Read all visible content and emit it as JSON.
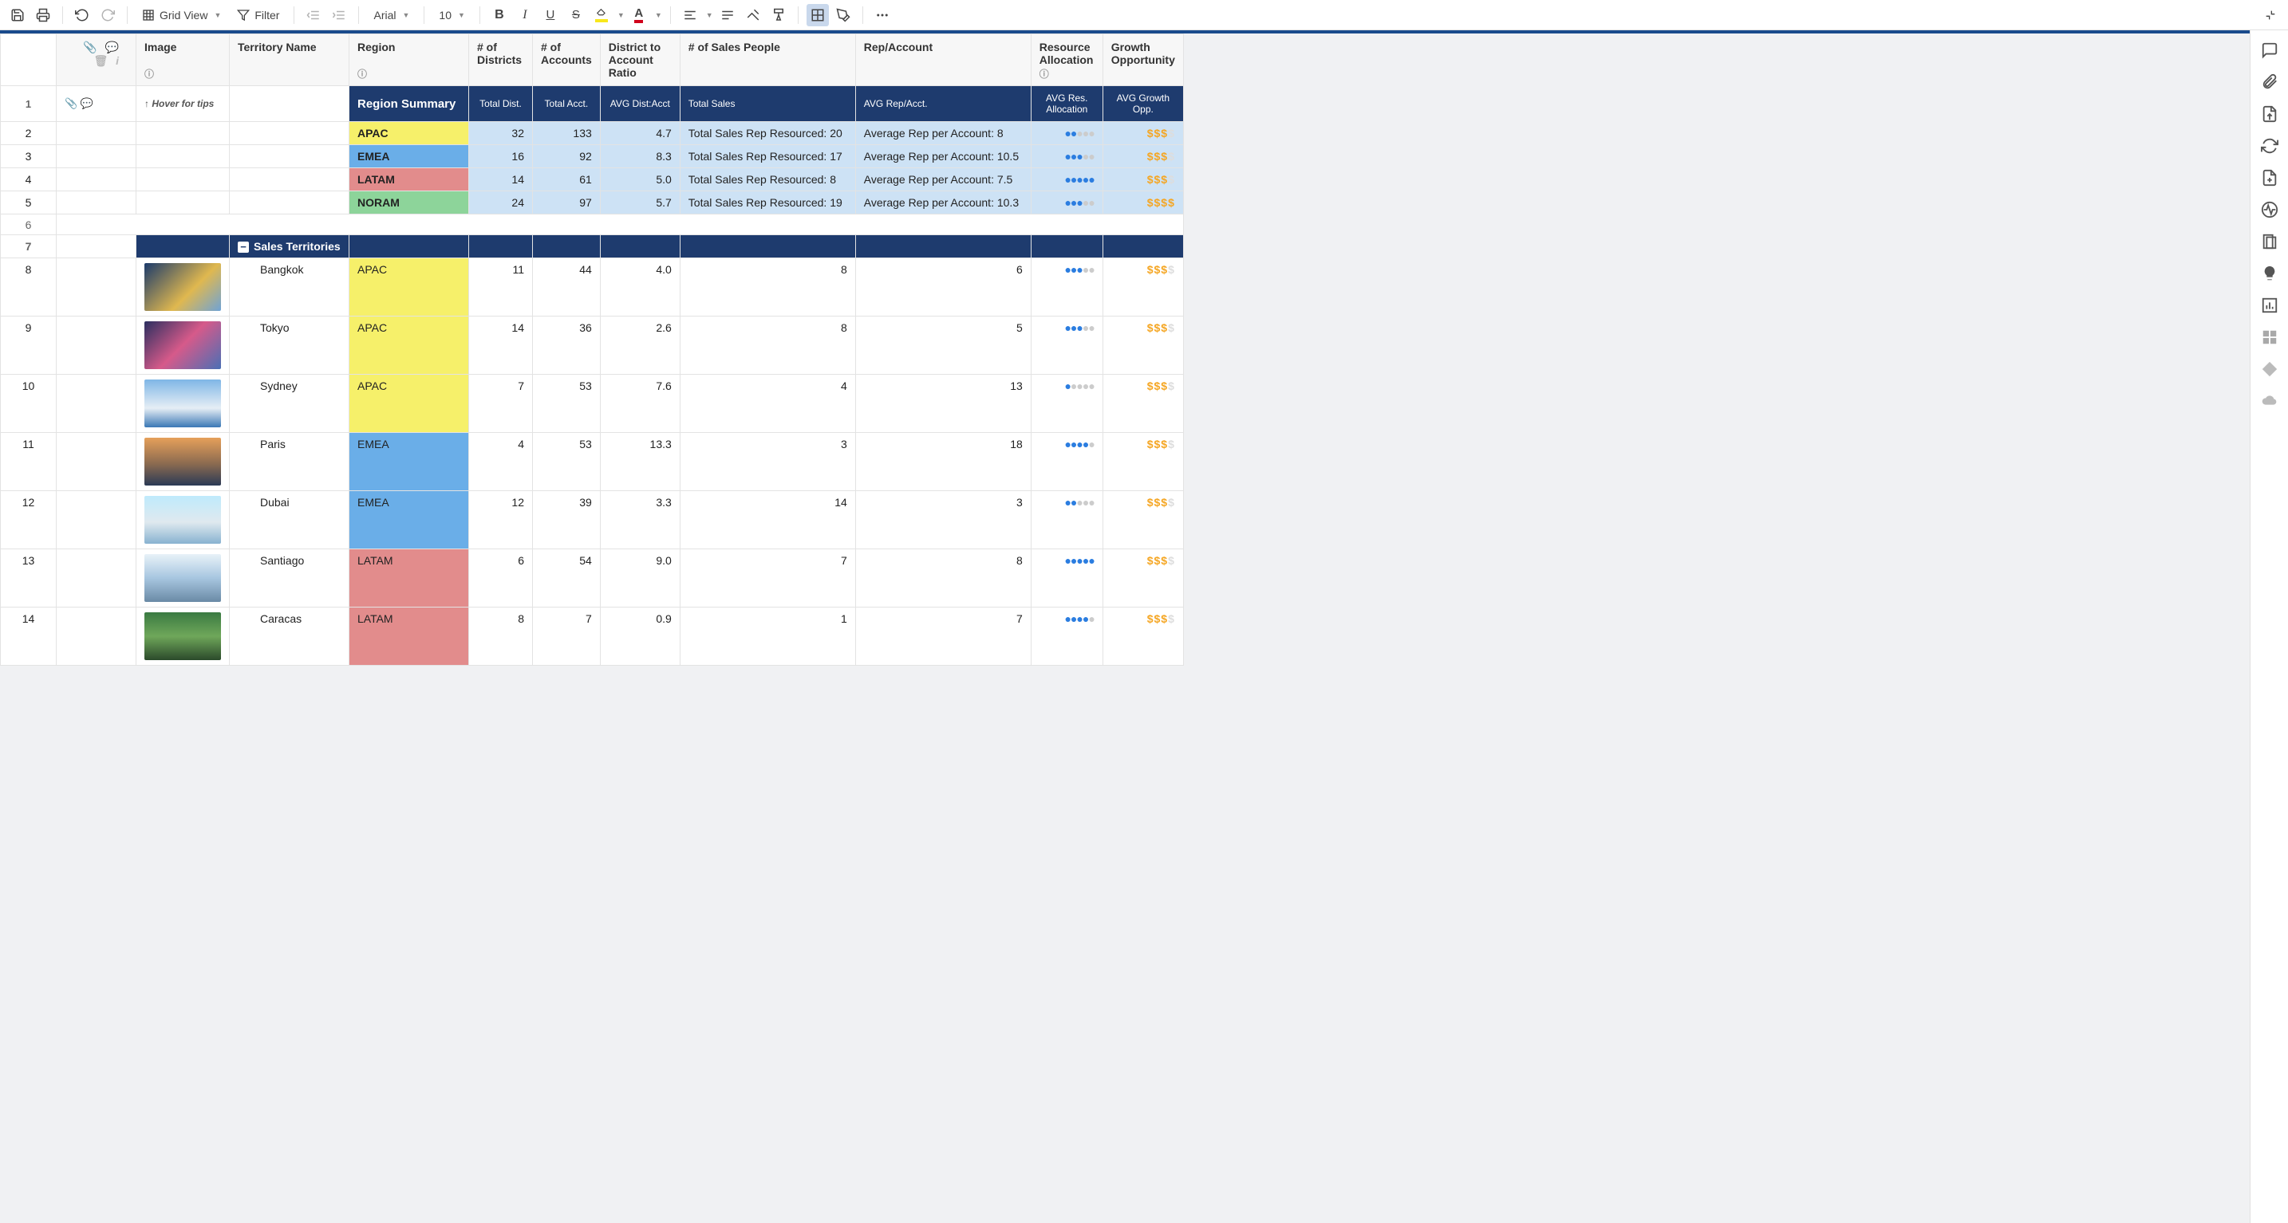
{
  "toolbar": {
    "view_label": "Grid View",
    "filter_label": "Filter",
    "font_label": "Arial",
    "font_size": "10"
  },
  "columns": {
    "image": "Image",
    "territory": "Territory Name",
    "region": "Region",
    "districts": "# of Districts",
    "accounts": "# of Accounts",
    "ratio": "District to Account Ratio",
    "sales_people": "# of Sales People",
    "rep_account": "Rep/Account",
    "resource_alloc": "Resource Allocation",
    "growth": "Growth Opportunity"
  },
  "hover_tip": "↑ Hover for tips",
  "summary": {
    "title": "Region Summary",
    "cols": {
      "total_dist": "Total Dist.",
      "total_acct": "Total Acct.",
      "avg_dist_acct": "AVG Dist:Acct",
      "total_sales": "Total Sales",
      "avg_rep_acct": "AVG Rep/Acct.",
      "avg_res_alloc": "AVG Res. Allocation",
      "avg_growth": "AVG Growth Opp."
    },
    "rows": [
      {
        "region": "APAC",
        "region_class": "reg-apac",
        "dist": "32",
        "acct": "133",
        "ratio": "4.7",
        "sales": "Total Sales Rep Resourced: 20",
        "rep": "Average Rep per Account: 8",
        "people_on": 2,
        "money_on": 3
      },
      {
        "region": "EMEA",
        "region_class": "reg-emea",
        "dist": "16",
        "acct": "92",
        "ratio": "8.3",
        "sales": "Total Sales Rep Resourced: 17",
        "rep": "Average Rep per Account: 10.5",
        "people_on": 3,
        "money_on": 3
      },
      {
        "region": "LATAM",
        "region_class": "reg-latam",
        "dist": "14",
        "acct": "61",
        "ratio": "5.0",
        "sales": "Total Sales Rep Resourced: 8",
        "rep": "Average Rep per Account: 7.5",
        "people_on": 5,
        "money_on": 3
      },
      {
        "region": "NORAM",
        "region_class": "reg-noram",
        "dist": "24",
        "acct": "97",
        "ratio": "5.7",
        "sales": "Total Sales Rep Resourced: 19",
        "rep": "Average Rep per Account: 10.3",
        "people_on": 3,
        "money_on": 4
      }
    ]
  },
  "territories_header": "Sales Territories",
  "territories": [
    {
      "row": "8",
      "name": "Bangkok",
      "region": "APAC",
      "region_class": "reg-apac",
      "dist": "11",
      "acct": "44",
      "ratio": "4.0",
      "sales": "8",
      "rep": "6",
      "people_on": 3,
      "money_on": 3,
      "money_total": 4,
      "img_grad": "linear-gradient(135deg,#1b3a6b,#e0b84f 60%,#6fa3d6)"
    },
    {
      "row": "9",
      "name": "Tokyo",
      "region": "APAC",
      "region_class": "reg-apac",
      "dist": "14",
      "acct": "36",
      "ratio": "2.6",
      "sales": "8",
      "rep": "5",
      "people_on": 3,
      "money_on": 3,
      "money_total": 4,
      "img_grad": "linear-gradient(135deg,#2b2f60,#d65a8a 50%,#4a6fb5)"
    },
    {
      "row": "10",
      "name": "Sydney",
      "region": "APAC",
      "region_class": "reg-apac",
      "dist": "7",
      "acct": "53",
      "ratio": "7.6",
      "sales": "4",
      "rep": "13",
      "people_on": 1,
      "money_on": 3,
      "money_total": 4,
      "img_grad": "linear-gradient(180deg,#7fb6e6,#e6eef5 60%,#3a78b5)"
    },
    {
      "row": "11",
      "name": "Paris",
      "region": "EMEA",
      "region_class": "reg-emea",
      "dist": "4",
      "acct": "53",
      "ratio": "13.3",
      "sales": "3",
      "rep": "18",
      "people_on": 4,
      "money_on": 3,
      "money_total": 4,
      "img_grad": "linear-gradient(180deg,#e6a05a,#8a6a50 55%,#2b3a55)"
    },
    {
      "row": "12",
      "name": "Dubai",
      "region": "EMEA",
      "region_class": "reg-emea",
      "dist": "12",
      "acct": "39",
      "ratio": "3.3",
      "sales": "14",
      "rep": "3",
      "people_on": 2,
      "money_on": 3,
      "money_total": 4,
      "img_grad": "linear-gradient(180deg,#bfeafc,#dfe9ef 55%,#88b2d0)"
    },
    {
      "row": "13",
      "name": "Santiago",
      "region": "LATAM",
      "region_class": "reg-latam",
      "dist": "6",
      "acct": "54",
      "ratio": "9.0",
      "sales": "7",
      "rep": "8",
      "people_on": 5,
      "money_on": 3,
      "money_total": 4,
      "img_grad": "linear-gradient(180deg,#e8f2f8,#a7c6e0 50%,#6a8aa5)"
    },
    {
      "row": "14",
      "name": "Caracas",
      "region": "LATAM",
      "region_class": "reg-latam",
      "dist": "8",
      "acct": "7",
      "ratio": "0.9",
      "sales": "1",
      "rep": "7",
      "people_on": 4,
      "money_on": 3,
      "money_total": 4,
      "img_grad": "linear-gradient(180deg,#3a7a42,#6fa75a 50%,#2b4a2b)"
    }
  ]
}
